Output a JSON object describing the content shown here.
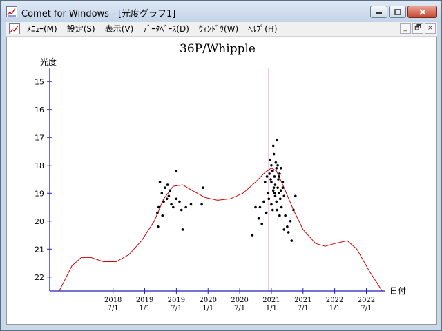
{
  "window": {
    "title": "Comet for Windows - [光度グラフ1]",
    "menu": [
      "ﾒﾆｭｰ(M)",
      "設定(S)",
      "表示(V)",
      "ﾃﾞｰﾀﾍﾞｰｽ(D)",
      "ｳｨﾝﾄﾞｳ(W)",
      "ﾍﾙﾌﾟ(H)"
    ],
    "mdi_buttons": [
      "_",
      "🗗",
      "×"
    ]
  },
  "chart_data": {
    "type": "scatter",
    "title": "36P/Whipple",
    "ylabel": "光度",
    "xlabel": "日付",
    "ylim": [
      22.5,
      14.5
    ],
    "y_reversed": true,
    "yticks": [
      15,
      16,
      17,
      18,
      19,
      20,
      21,
      22
    ],
    "xticks": [
      {
        "year": "2018",
        "md": "7/1",
        "x": 2018.5
      },
      {
        "year": "2019",
        "md": "1/1",
        "x": 2019.0
      },
      {
        "year": "2019",
        "md": "7/1",
        "x": 2019.5
      },
      {
        "year": "2020",
        "md": "1/1",
        "x": 2020.0
      },
      {
        "year": "2020",
        "md": "7/1",
        "x": 2020.5
      },
      {
        "year": "2021",
        "md": "1/1",
        "x": 2021.0
      },
      {
        "year": "2021",
        "md": "7/1",
        "x": 2021.5
      },
      {
        "year": "2022",
        "md": "1/1",
        "x": 2022.0
      },
      {
        "year": "2022",
        "md": "7/1",
        "x": 2022.5
      }
    ],
    "xlim": [
      2017.5,
      2022.8
    ],
    "perihelion_line_x": 2020.96,
    "curve": [
      [
        2017.65,
        22.5
      ],
      [
        2017.85,
        21.6
      ],
      [
        2018.0,
        21.3
      ],
      [
        2018.15,
        21.3
      ],
      [
        2018.35,
        21.45
      ],
      [
        2018.55,
        21.45
      ],
      [
        2018.75,
        21.2
      ],
      [
        2018.95,
        20.7
      ],
      [
        2019.15,
        20.0
      ],
      [
        2019.3,
        19.2
      ],
      [
        2019.45,
        18.75
      ],
      [
        2019.6,
        18.7
      ],
      [
        2019.75,
        18.9
      ],
      [
        2019.95,
        19.15
      ],
      [
        2020.15,
        19.25
      ],
      [
        2020.35,
        19.2
      ],
      [
        2020.55,
        19.0
      ],
      [
        2020.75,
        18.6
      ],
      [
        2020.9,
        18.25
      ],
      [
        2021.0,
        18.1
      ],
      [
        2021.08,
        18.2
      ],
      [
        2021.2,
        18.8
      ],
      [
        2021.35,
        19.6
      ],
      [
        2021.5,
        20.3
      ],
      [
        2021.7,
        20.8
      ],
      [
        2021.85,
        20.9
      ],
      [
        2022.0,
        20.8
      ],
      [
        2022.2,
        20.7
      ],
      [
        2022.35,
        21.0
      ],
      [
        2022.55,
        21.8
      ],
      [
        2022.75,
        22.5
      ]
    ],
    "series": [
      {
        "values": [
          [
            2019.24,
            18.6
          ],
          [
            2019.27,
            19.0
          ],
          [
            2019.3,
            19.3
          ],
          [
            2019.22,
            19.5
          ],
          [
            2019.2,
            19.7
          ],
          [
            2019.21,
            20.2
          ],
          [
            2019.32,
            18.8
          ],
          [
            2019.35,
            19.2
          ],
          [
            2019.38,
            19.1
          ],
          [
            2019.4,
            18.9
          ],
          [
            2019.42,
            19.4
          ],
          [
            2019.45,
            19.5
          ],
          [
            2019.5,
            18.2
          ],
          [
            2019.5,
            19.2
          ],
          [
            2019.55,
            19.3
          ],
          [
            2019.58,
            19.6
          ],
          [
            2019.6,
            20.3
          ],
          [
            2019.65,
            19.5
          ],
          [
            2019.73,
            19.4
          ],
          [
            2019.9,
            19.4
          ],
          [
            2019.92,
            18.8
          ],
          [
            2019.36,
            18.7
          ],
          [
            2019.28,
            19.8
          ],
          [
            2020.7,
            20.5
          ],
          [
            2020.75,
            19.5
          ],
          [
            2020.8,
            19.9
          ],
          [
            2020.82,
            19.5
          ],
          [
            2020.85,
            20.1
          ],
          [
            2020.88,
            19.3
          ],
          [
            2020.9,
            18.6
          ],
          [
            2020.92,
            19.7
          ],
          [
            2020.95,
            19.0
          ],
          [
            2020.97,
            18.3
          ],
          [
            2020.98,
            17.8
          ],
          [
            2020.99,
            18.5
          ],
          [
            2021.0,
            18.6
          ],
          [
            2021.02,
            18.2
          ],
          [
            2021.03,
            17.3
          ],
          [
            2021.04,
            17.6
          ],
          [
            2021.05,
            18.4
          ],
          [
            2021.06,
            18.7
          ],
          [
            2021.07,
            17.9
          ],
          [
            2021.08,
            18.1
          ],
          [
            2021.09,
            17.1
          ],
          [
            2021.1,
            18.8
          ],
          [
            2021.11,
            18.5
          ],
          [
            2021.12,
            19.0
          ],
          [
            2021.13,
            18.3
          ],
          [
            2021.14,
            19.2
          ],
          [
            2021.15,
            18.9
          ],
          [
            2021.16,
            19.5
          ],
          [
            2021.18,
            18.6
          ],
          [
            2021.2,
            19.1
          ],
          [
            2021.22,
            19.8
          ],
          [
            2021.25,
            20.2
          ],
          [
            2021.27,
            20.4
          ],
          [
            2021.3,
            20.0
          ],
          [
            2021.32,
            20.7
          ],
          [
            2021.35,
            19.6
          ],
          [
            2021.38,
            19.1
          ],
          [
            2021.0,
            19.4
          ],
          [
            2021.02,
            19.6
          ],
          [
            2021.05,
            19.0
          ],
          [
            2021.08,
            19.3
          ],
          [
            2021.1,
            18.0
          ],
          [
            2021.12,
            18.4
          ],
          [
            2021.03,
            18.9
          ],
          [
            2021.06,
            19.1
          ],
          [
            2020.96,
            19.2
          ],
          [
            2020.93,
            18.4
          ],
          [
            2021.15,
            18.1
          ],
          [
            2021.18,
            18.8
          ],
          [
            2021.0,
            18.0
          ],
          [
            2021.04,
            18.8
          ],
          [
            2021.09,
            19.6
          ],
          [
            2021.13,
            19.8
          ],
          [
            2021.2,
            20.3
          ]
        ]
      }
    ],
    "colors": {
      "axis": "#2020c0",
      "curve": "#d00000",
      "perihelion": "#c000c0",
      "points": "#000000"
    }
  }
}
